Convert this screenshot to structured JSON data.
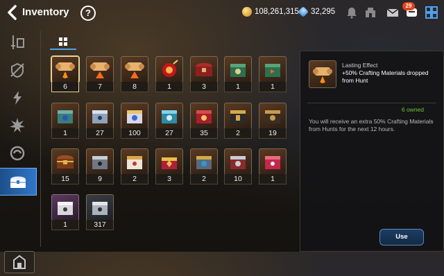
{
  "header": {
    "title": "Inventory",
    "help_label": "?",
    "gold": "108,261,315",
    "crystals": "32,295",
    "mail_badge": "29"
  },
  "sidebar": {
    "items": [
      {
        "icon": "hero-sword-icon"
      },
      {
        "icon": "unequip-icon"
      },
      {
        "icon": "lightning-icon"
      },
      {
        "icon": "artifact-burst-icon"
      },
      {
        "icon": "catalyst-orb-icon"
      },
      {
        "icon": "chest-icon",
        "active": true
      }
    ],
    "bottom_icon": "storage-house-icon"
  },
  "items": [
    {
      "name": "Lasting Effect",
      "count": "6",
      "selected": true
    },
    {
      "name": "scroll-boost",
      "count": "7"
    },
    {
      "name": "scroll-boost",
      "count": "8"
    },
    {
      "name": "bomb-boost",
      "count": "1"
    },
    {
      "name": "red-chest",
      "count": "3"
    },
    {
      "name": "green-box",
      "count": "1"
    },
    {
      "name": "green-box-b",
      "count": "1"
    },
    {
      "name": "green-blue-box",
      "count": "1"
    },
    {
      "name": "silver-box",
      "count": "27"
    },
    {
      "name": "gold-blue-box",
      "count": "100"
    },
    {
      "name": "cyan-box",
      "count": "27"
    },
    {
      "name": "red-box",
      "count": "35"
    },
    {
      "name": "black-gold-box",
      "count": "2"
    },
    {
      "name": "dark-gold-box",
      "count": "19"
    },
    {
      "name": "treasure-chest",
      "count": "15"
    },
    {
      "name": "steel-box",
      "count": "9"
    },
    {
      "name": "gold-white-box",
      "count": "2"
    },
    {
      "name": "jewel-chest",
      "count": "3"
    },
    {
      "name": "steel-blue-box",
      "count": "2"
    },
    {
      "name": "silver-red-box",
      "count": "10"
    },
    {
      "name": "red-crimson-box",
      "count": "1"
    },
    {
      "name": "white-box",
      "count": "1",
      "purple": true
    },
    {
      "name": "dark-steel-box",
      "count": "317"
    }
  ],
  "detail": {
    "name": "Lasting Effect",
    "effect": "+50% Crafting Materials dropped from Hunt",
    "owned": "6 owned",
    "description": "You will receive an extra 50% Crafting Materials from Hunts for the next 12 hours.",
    "use_label": "Use"
  },
  "colors": {
    "accent_blue": "#2f76c8",
    "owned_green": "#6ec63c",
    "selected_gold": "#e9d49a"
  }
}
